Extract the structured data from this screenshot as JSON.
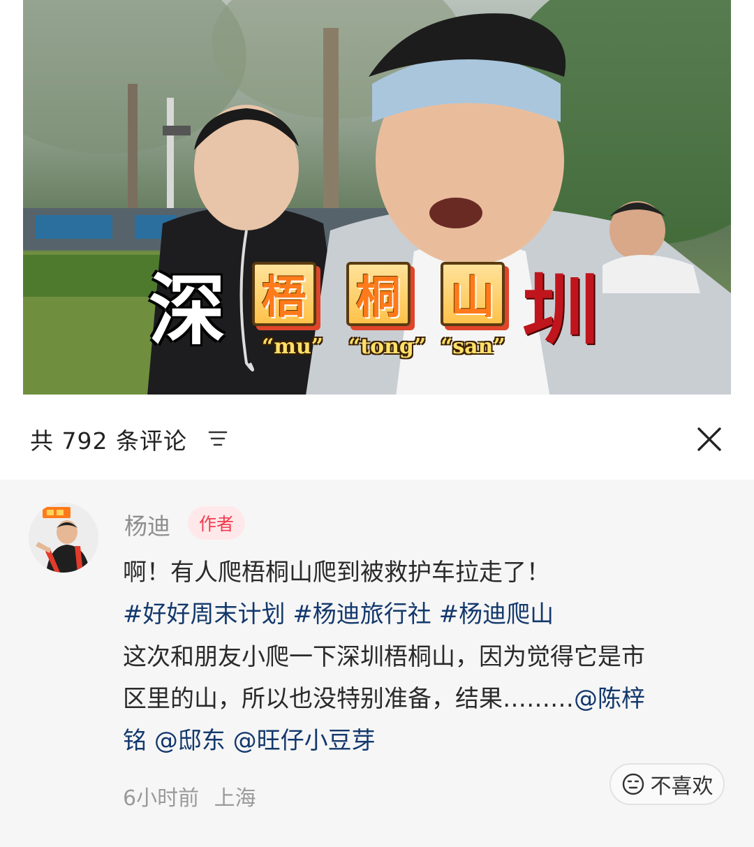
{
  "video": {
    "subtitle_chars": [
      "深",
      "梧",
      "桐",
      "山",
      "圳"
    ],
    "pinyin": [
      "“mu”",
      "“tong”",
      "“san”"
    ]
  },
  "comments_panel": {
    "count_title": "共 792 条评论",
    "sort_icon": "sort-lines-icon",
    "close_icon": "close-icon"
  },
  "comment": {
    "author": "杨迪",
    "author_badge": "作者",
    "line1": "啊！有人爬梧桐山爬到被救护车拉走了！",
    "tags": [
      "#好好周末计划",
      "#杨迪旅行社",
      "#杨迪爬山"
    ],
    "line3": "这次和朋友小爬一下深圳梧桐山，因为觉得它是市",
    "line4_text": "区里的山，所以也没特别准备，结果………",
    "line4_mention": "@陈梓",
    "line5_mentions": [
      "铭",
      "@邸东",
      "@旺仔小豆芽"
    ],
    "time": "6小时前",
    "location": "上海",
    "dislike_label": "不喜欢",
    "dislike_icon": "frown-face-icon"
  },
  "colors": {
    "tag_color": "#13386c",
    "badge_bg": "#ffe8ea",
    "badge_text": "#ef3b4d",
    "sheet_bg": "#f6f6f6"
  }
}
